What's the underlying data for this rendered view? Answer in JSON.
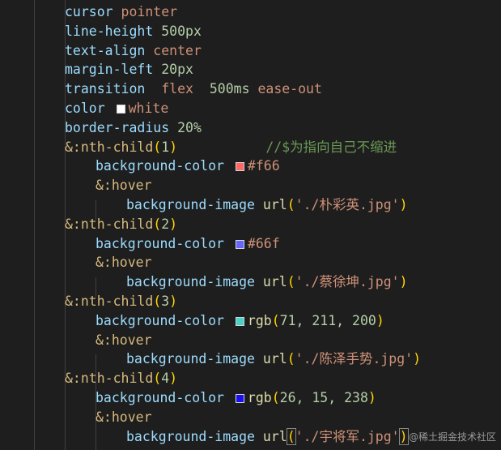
{
  "colors": {
    "background": "#1e1e1e",
    "property": "#9cdcfe",
    "value": "#ce9178",
    "number": "#b5cea8",
    "selector": "#d7ba7d",
    "comment": "#6a9955",
    "paren": "#ffd700"
  },
  "code": {
    "l1": {
      "prop": "cursor",
      "val": "pointer"
    },
    "l2": {
      "prop": "line-height",
      "num": "500px"
    },
    "l3": {
      "prop": "text-align",
      "val": "center"
    },
    "l4": {
      "prop": "margin-left",
      "num": "20px"
    },
    "l5": {
      "prop": "transition",
      "val1": "flex",
      "num": "500ms",
      "val2": "ease-out"
    },
    "l6": {
      "prop": "color",
      "swatch": "#ffffff",
      "val": "white"
    },
    "l7": {
      "prop": "border-radius",
      "num": "20%"
    },
    "l8": {
      "sel": "&:nth-child",
      "open": "(",
      "num": "1",
      "close": ")",
      "comment": "//$为指向自己不缩进"
    },
    "l9": {
      "prop": "background-color",
      "swatch": "#ff6666",
      "val": "#f66"
    },
    "l10": {
      "sel": "&:hover"
    },
    "l11": {
      "prop": "background-image",
      "fn": "url",
      "open": "(",
      "str": "'./朴彩英.jpg'",
      "close": ")"
    },
    "l12": {
      "sel": "&:nth-child",
      "open": "(",
      "num": "2",
      "close": ")"
    },
    "l13": {
      "prop": "background-color",
      "swatch": "#6666ff",
      "val": "#66f"
    },
    "l14": {
      "sel": "&:hover"
    },
    "l15": {
      "prop": "background-image",
      "fn": "url",
      "open": "(",
      "str": "'./蔡徐坤.jpg'",
      "close": ")"
    },
    "l16": {
      "sel": "&:nth-child",
      "open": "(",
      "num": "3",
      "close": ")"
    },
    "l17": {
      "prop": "background-color",
      "swatch": "#47d3c8",
      "fn": "rgb",
      "open": "(",
      "args": "71, 211, 200",
      "close": ")"
    },
    "l18": {
      "sel": "&:hover"
    },
    "l19": {
      "prop": "background-image",
      "fn": "url",
      "open": "(",
      "str": "'./陈泽手势.jpg'",
      "close": ")"
    },
    "l20": {
      "sel": "&:nth-child",
      "open": "(",
      "num": "4",
      "close": ")"
    },
    "l21": {
      "prop": "background-color",
      "swatch": "#1a0fee",
      "fn": "rgb",
      "open": "(",
      "args": "26, 15, 238",
      "close": ")"
    },
    "l22": {
      "sel": "&:hover"
    },
    "l23": {
      "prop": "background-image",
      "fn": "url",
      "open": "(",
      "str": "'./宇将军.jpg'",
      "close": ")"
    }
  },
  "watermark": "@稀土掘金技术社区"
}
